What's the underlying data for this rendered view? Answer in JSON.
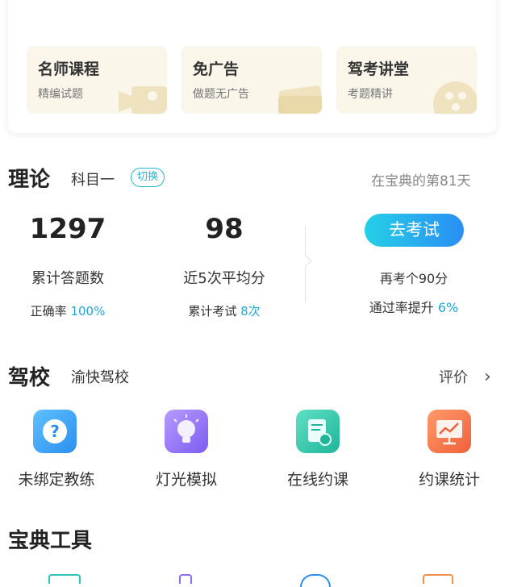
{
  "promos": [
    {
      "title": "名师课程",
      "subtitle": "精编试题"
    },
    {
      "title": "免广告",
      "subtitle": "做题无广告"
    },
    {
      "title": "驾考讲堂",
      "subtitle": "考题精讲"
    }
  ],
  "theory": {
    "title": "理论",
    "subject": "科目一",
    "switch_label": "切换",
    "days_note": "在宝典的第81天",
    "total_answers": "1297",
    "total_answers_label": "累计答题数",
    "accuracy_prefix": "正确率",
    "accuracy_value": "100%",
    "avg_score": "98",
    "avg_score_label": "近5次平均分",
    "exams_prefix": "累计考试",
    "exams_value": "8次",
    "exam_button": "去考试",
    "retake_note": "再考个90分",
    "pass_rate_prefix": "通过率提升",
    "pass_rate_value": "6%"
  },
  "school": {
    "title": "驾校",
    "name": "渝快驾校",
    "review_label": "评价",
    "items": [
      {
        "label": "未绑定教练",
        "icon": "question-icon",
        "color": "#2b8ff0"
      },
      {
        "label": "灯光模拟",
        "icon": "lightbulb-icon",
        "color": "#8f6df0"
      },
      {
        "label": "在线约课",
        "icon": "schedule-doc-icon",
        "color": "#1fc2a8"
      },
      {
        "label": "约课统计",
        "icon": "chart-board-icon",
        "color": "#f0653a"
      }
    ]
  },
  "tools": {
    "title": "宝典工具"
  }
}
